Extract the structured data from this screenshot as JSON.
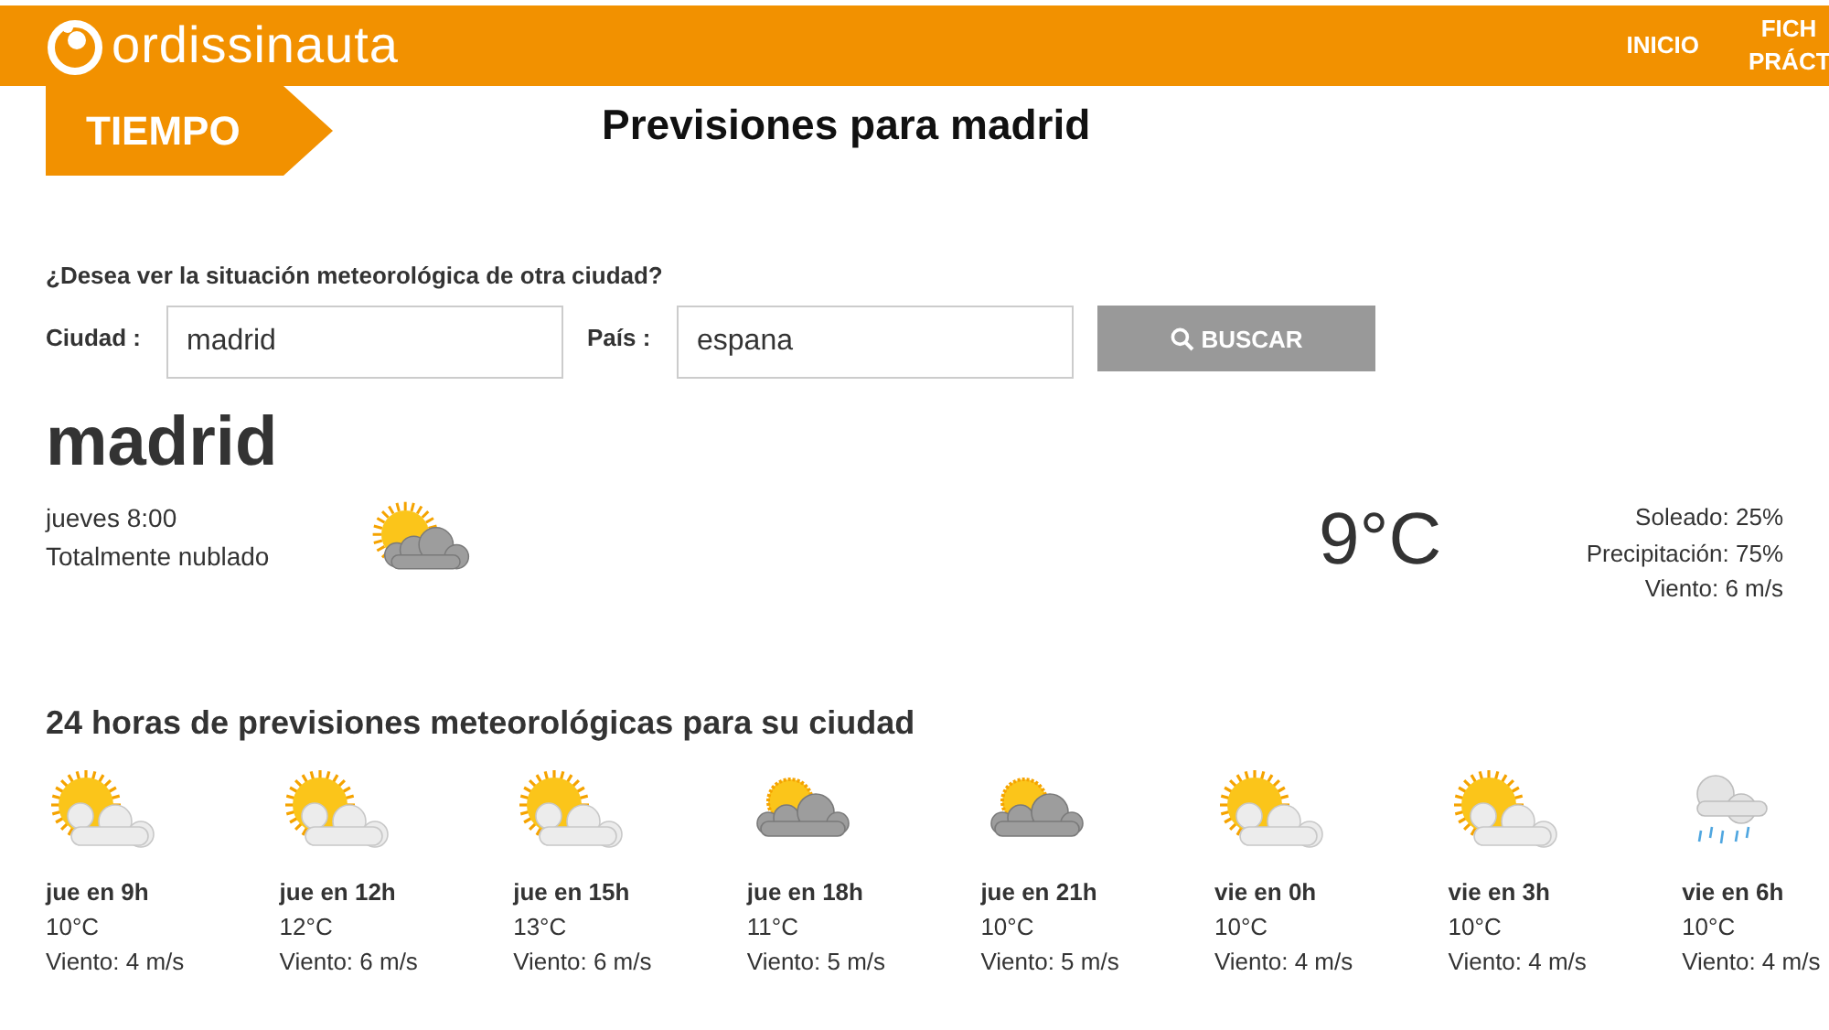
{
  "header": {
    "logo": "ordissinauta",
    "nav": [
      {
        "label": "INICIO"
      },
      {
        "label": "FICH PRÁCT"
      }
    ]
  },
  "section_tab": "TIEMPO",
  "page_title": "Previsiones para madrid",
  "search": {
    "prompt": "¿Desea ver la situación meteorológica de otra ciudad?",
    "city_label": "Ciudad :",
    "city_value": "madrid",
    "country_label": "País :",
    "country_value": "espana",
    "button": "BUSCAR"
  },
  "current": {
    "city": "madrid",
    "time": "jueves 8:00",
    "condition": "Totalmente nublado",
    "kind": "cloudy",
    "temperature": "9°C",
    "details": [
      "Soleado: 25%",
      "Precipitación: 75%",
      "Viento: 6 m/s"
    ]
  },
  "forecast_title": "24 horas de previsiones meteorológicas para su ciudad",
  "forecast": [
    {
      "when": "jue en 9h",
      "temp": "10°C",
      "wind": "Viento: 4 m/s",
      "kind": "partly"
    },
    {
      "when": "jue en 12h",
      "temp": "12°C",
      "wind": "Viento: 6 m/s",
      "kind": "partly"
    },
    {
      "when": "jue en 15h",
      "temp": "13°C",
      "wind": "Viento: 6 m/s",
      "kind": "partly"
    },
    {
      "when": "jue en 18h",
      "temp": "11°C",
      "wind": "Viento: 5 m/s",
      "kind": "cloudy"
    },
    {
      "when": "jue en 21h",
      "temp": "10°C",
      "wind": "Viento: 5 m/s",
      "kind": "cloudy"
    },
    {
      "when": "vie en 0h",
      "temp": "10°C",
      "wind": "Viento: 4 m/s",
      "kind": "partly"
    },
    {
      "when": "vie en 3h",
      "temp": "10°C",
      "wind": "Viento: 4 m/s",
      "kind": "partly"
    },
    {
      "when": "vie en 6h",
      "temp": "10°C",
      "wind": "Viento: 4 m/s",
      "kind": "rain"
    }
  ]
}
